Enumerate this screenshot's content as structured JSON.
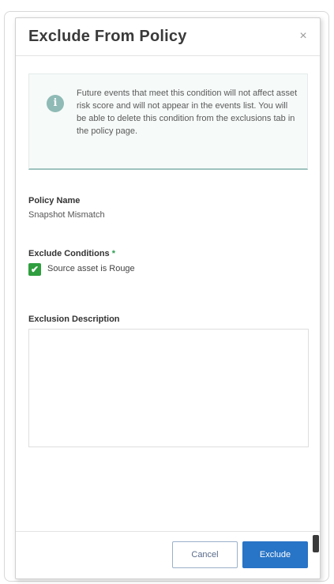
{
  "dialog": {
    "title": "Exclude From Policy",
    "close_label": "×"
  },
  "info": {
    "icon": "i",
    "text": "Future events that meet this condition will not affect asset risk score and will not appear in the events list. You will be able to delete this condition from the exclusions tab in the policy page."
  },
  "policy": {
    "label": "Policy Name",
    "value": "Snapshot Mismatch"
  },
  "conditions": {
    "label": "Exclude Conditions",
    "required_marker": "*",
    "items": [
      {
        "label": "Source asset is Rouge",
        "checked": true
      }
    ]
  },
  "description": {
    "label": "Exclusion Description",
    "value": ""
  },
  "footer": {
    "cancel_label": "Cancel",
    "exclude_label": "Exclude"
  },
  "colors": {
    "primary": "#2874c6",
    "check_green": "#2f9e3f",
    "info_accent": "#9fc3bf"
  }
}
